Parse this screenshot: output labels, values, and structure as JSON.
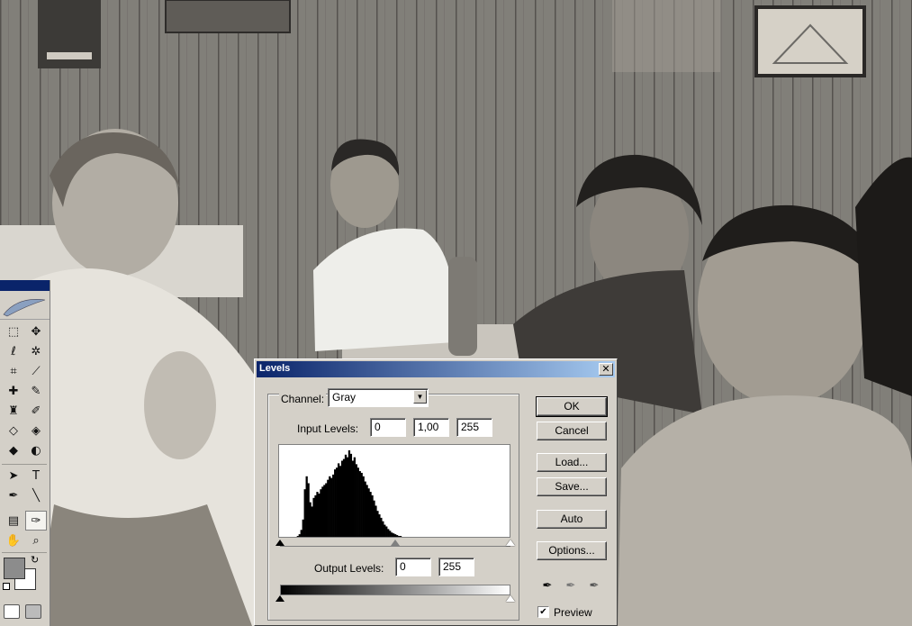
{
  "dialog": {
    "title": "Levels",
    "close_glyph": "✕",
    "channel_label": "Channel:",
    "channel_value": "Gray",
    "input_levels_label": "Input Levels:",
    "input_black": "0",
    "input_gamma": "1,00",
    "input_white": "255",
    "output_levels_label": "Output Levels:",
    "output_black": "0",
    "output_white": "255",
    "buttons": {
      "ok": "OK",
      "cancel": "Cancel",
      "load": "Load...",
      "save": "Save...",
      "auto": "Auto",
      "options": "Options..."
    },
    "preview_label": "Preview",
    "preview_checked": true,
    "check_glyph": "✔"
  },
  "histogram": {
    "bins": [
      0,
      0,
      0,
      0,
      0,
      0,
      0,
      0,
      0,
      0,
      1,
      3,
      8,
      20,
      55,
      70,
      62,
      40,
      35,
      45,
      48,
      52,
      50,
      55,
      58,
      60,
      62,
      66,
      70,
      68,
      72,
      78,
      80,
      85,
      82,
      88,
      90,
      95,
      92,
      100,
      96,
      88,
      92,
      84,
      80,
      76,
      74,
      70,
      64,
      60,
      56,
      52,
      48,
      42,
      36,
      30,
      26,
      22,
      18,
      14,
      12,
      9,
      7,
      5,
      4,
      3,
      2,
      1,
      1,
      0,
      0,
      0,
      0,
      0,
      0,
      0,
      0,
      0,
      0,
      0,
      0,
      0,
      0,
      0,
      0,
      0,
      0,
      0,
      0,
      0,
      0,
      0,
      0,
      0,
      0,
      0,
      0,
      0,
      0,
      0,
      0,
      0,
      0,
      0,
      0,
      0,
      0,
      0,
      0,
      0,
      0,
      0,
      0,
      0,
      0,
      0,
      0,
      0,
      0,
      0,
      0,
      0,
      0,
      0,
      0,
      0,
      0,
      0,
      0,
      0
    ]
  },
  "toolbox": {
    "tools": [
      {
        "name": "marquee-tool",
        "glyph": "⬚"
      },
      {
        "name": "move-tool",
        "glyph": "✥"
      },
      {
        "name": "lasso-tool",
        "glyph": "ℓ"
      },
      {
        "name": "magic-wand-tool",
        "glyph": "✲"
      },
      {
        "name": "crop-tool",
        "glyph": "⌗"
      },
      {
        "name": "slice-tool",
        "glyph": "⟋"
      },
      {
        "name": "healing-brush-tool",
        "glyph": "✚"
      },
      {
        "name": "brush-tool",
        "glyph": "✎"
      },
      {
        "name": "clone-stamp-tool",
        "glyph": "♜"
      },
      {
        "name": "history-brush-tool",
        "glyph": "✐"
      },
      {
        "name": "eraser-tool",
        "glyph": "◇"
      },
      {
        "name": "paint-bucket-tool",
        "glyph": "◈"
      },
      {
        "name": "blur-tool",
        "glyph": "◆"
      },
      {
        "name": "dodge-tool",
        "glyph": "◐"
      },
      {
        "name": "path-selection-tool",
        "glyph": "➤"
      },
      {
        "name": "type-tool",
        "glyph": "T"
      },
      {
        "name": "pen-tool",
        "glyph": "✒"
      },
      {
        "name": "line-tool",
        "glyph": "╲"
      },
      {
        "name": "notes-tool",
        "glyph": "▤"
      },
      {
        "name": "eyedropper-tool",
        "glyph": "✑"
      },
      {
        "name": "hand-tool",
        "glyph": "✋"
      },
      {
        "name": "zoom-tool",
        "glyph": "⌕"
      }
    ],
    "active_tool": "eyedropper-tool"
  }
}
